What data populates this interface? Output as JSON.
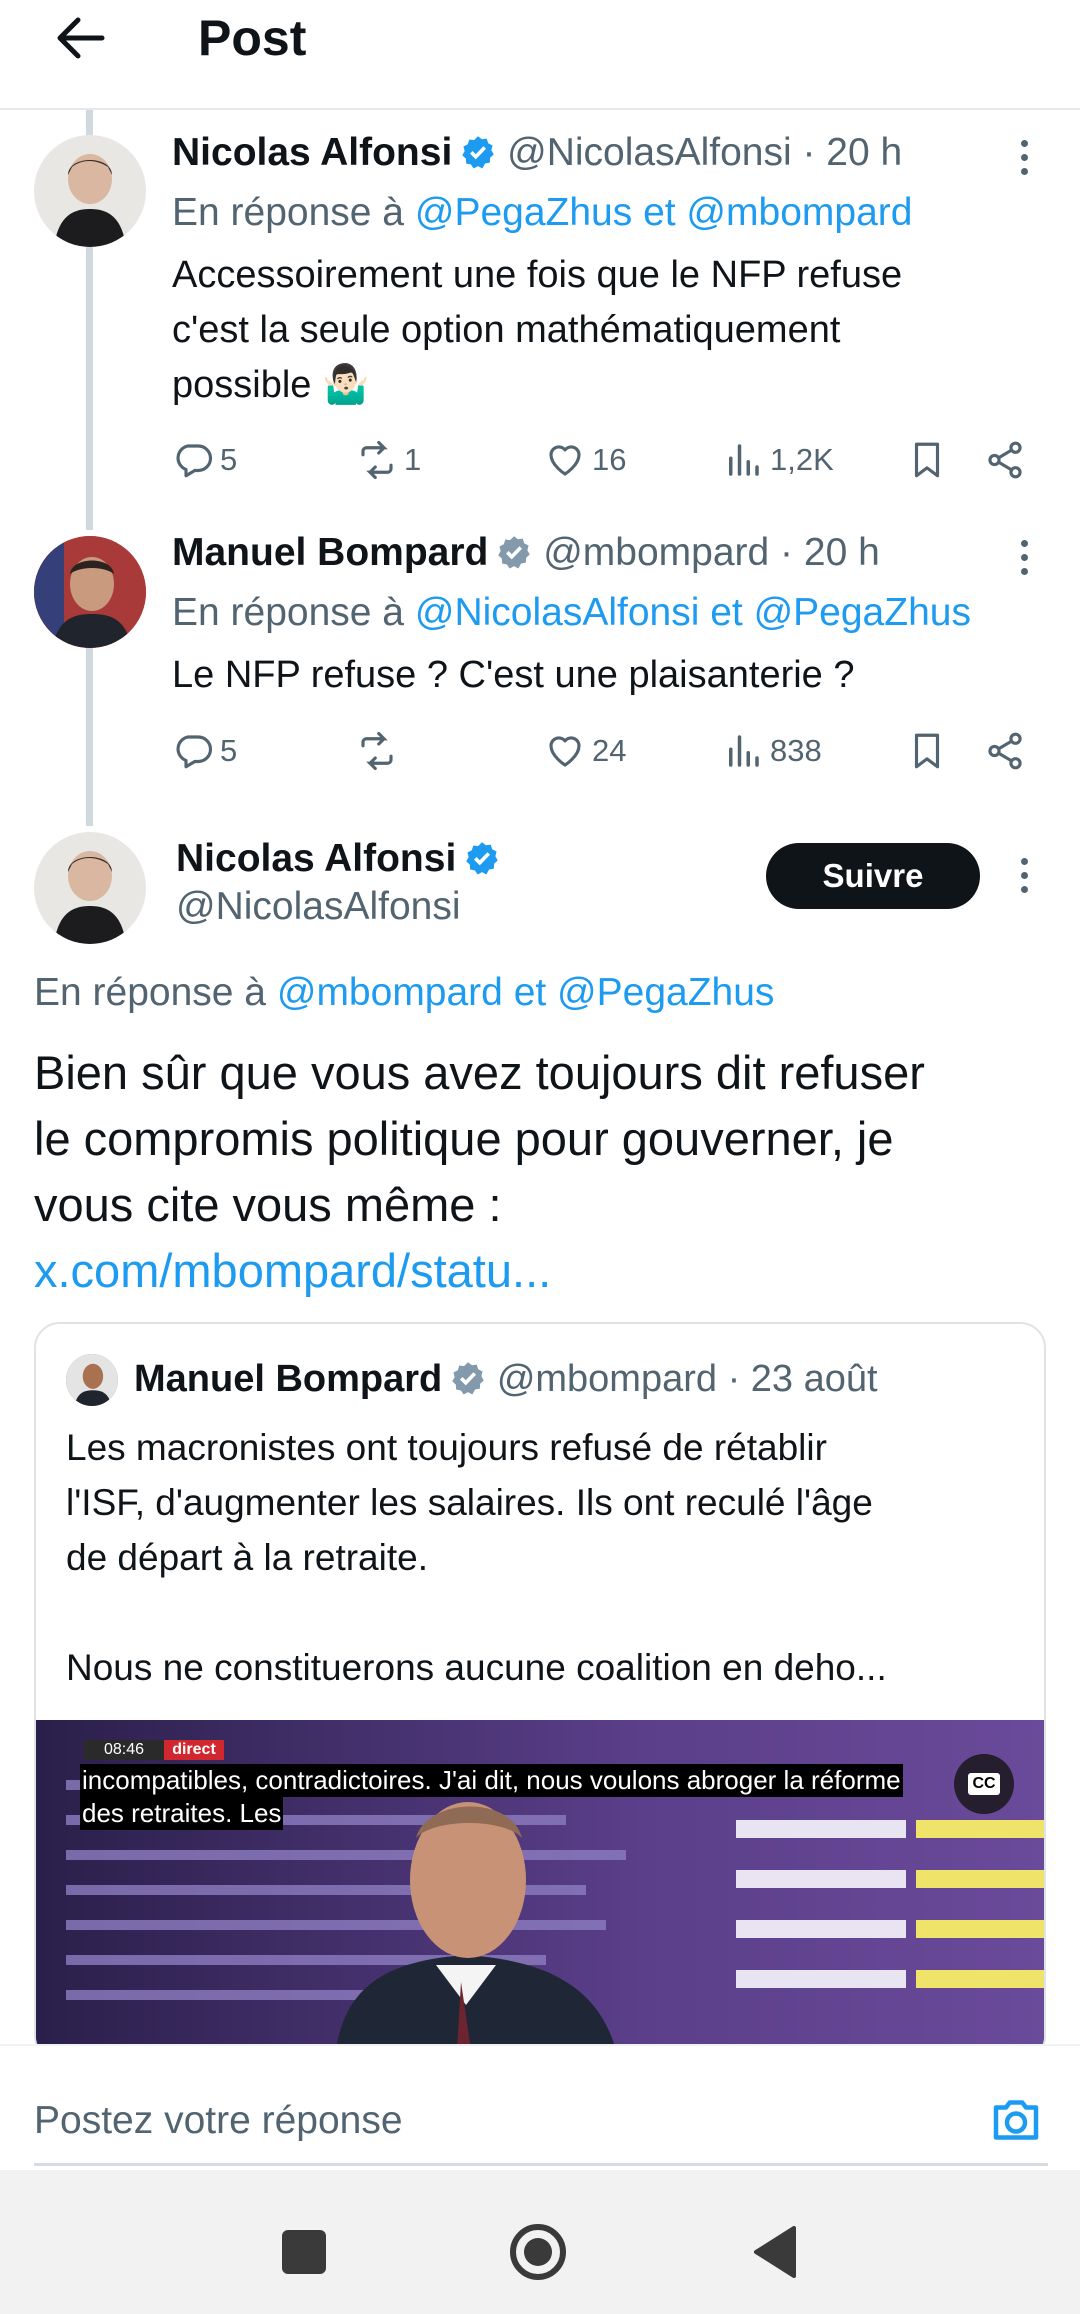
{
  "header": {
    "title": "Post"
  },
  "replies": [
    {
      "name": "Nicolas Alfonsi",
      "handle_time": "@NicolasAlfonsi · 20 h",
      "reply_prefix": "En réponse à",
      "reply_mentions": "@PegaZhus et @mbompard",
      "text_lines": [
        "Accessoirement une fois que le NFP refuse",
        "c'est la seule option mathématiquement",
        "possible 🤷🏻‍♂️"
      ],
      "stats": {
        "replies": "5",
        "reposts": "1",
        "likes": "16",
        "views": "1,2K"
      }
    },
    {
      "name": "Manuel Bompard",
      "handle_time": "@mbompard · 20 h",
      "reply_prefix": "En réponse à",
      "reply_mentions": "@NicolasAlfonsi et @PegaZhus",
      "text_lines": [
        "Le NFP refuse ? C'est une plaisanterie ?"
      ],
      "stats": {
        "replies": "5",
        "reposts": "",
        "likes": "24",
        "views": "838"
      }
    }
  ],
  "main_post": {
    "name": "Nicolas Alfonsi",
    "handle": "@NicolasAlfonsi",
    "follow_label": "Suivre",
    "reply_prefix": "En réponse à",
    "reply_mentions": "@mbompard et @PegaZhus",
    "text_lines": [
      "Bien sûr que vous avez toujours dit refuser",
      "le compromis politique pour gouverner, je",
      "vous cite vous même :"
    ],
    "link": "x.com/mbompard/statu..."
  },
  "quote": {
    "name": "Manuel Bompard",
    "handle_time": "@mbompard · 23 août",
    "text_lines": [
      "Les macronistes ont toujours refusé de rétablir",
      "l'ISF, d'augmenter les salaires. Ils ont reculé l'âge",
      "de départ à la retraite.",
      "",
      "Nous ne constituerons aucune coalition en deho..."
    ],
    "video": {
      "time": "08:46",
      "live": "direct",
      "caption_line1": "incompatibles, contradictoires. J'ai dit, nous voulons abroger la réforme",
      "caption_line2": "des retraites. Les",
      "cc": "CC"
    }
  },
  "composer": {
    "placeholder": "Postez votre réponse"
  },
  "colors": {
    "accent": "#1d9bf0",
    "text": "#0f1419",
    "secondary": "#536471",
    "verified": "#1d9bf0"
  }
}
